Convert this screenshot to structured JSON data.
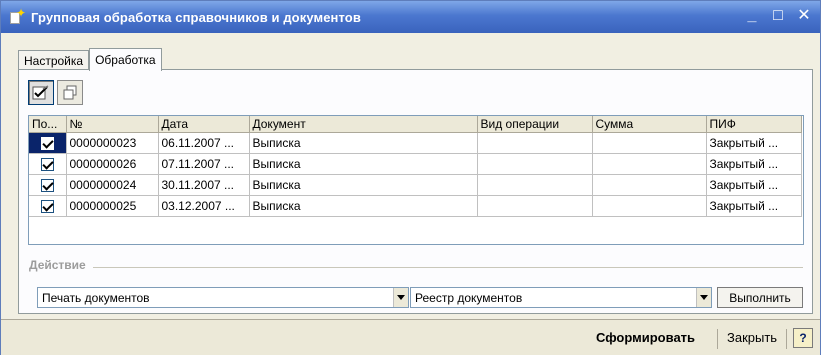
{
  "window": {
    "title": "Групповая обработка справочников и документов",
    "minimize": "_",
    "maximize": "□",
    "close": "✕",
    "title_icon": "document-star-icon"
  },
  "tabs": [
    {
      "label": "Настройка",
      "active": false
    },
    {
      "label": "Обработка",
      "active": true
    }
  ],
  "toolbar": {
    "check_all_icon": "check-all-icon",
    "copy_icon": "copy-icon"
  },
  "table": {
    "columns": [
      "По...",
      "№",
      "Дата",
      "Документ",
      "Вид операции",
      "Сумма",
      "ПИФ"
    ],
    "rows": [
      {
        "checked": true,
        "number": "0000000023",
        "date": "06.11.2007 ...",
        "document": "Выписка",
        "operation": "",
        "sum": "",
        "pif": "Закрытый ..."
      },
      {
        "checked": true,
        "number": "0000000026",
        "date": "07.11.2007 ...",
        "document": "Выписка",
        "operation": "",
        "sum": "",
        "pif": "Закрытый ..."
      },
      {
        "checked": true,
        "number": "0000000024",
        "date": "30.11.2007 ...",
        "document": "Выписка",
        "operation": "",
        "sum": "",
        "pif": "Закрытый ..."
      },
      {
        "checked": true,
        "number": "0000000025",
        "date": "03.12.2007 ...",
        "document": "Выписка",
        "operation": "",
        "sum": "",
        "pif": "Закрытый ..."
      }
    ]
  },
  "action": {
    "section_label": "Действие",
    "action_value": "Печать документов",
    "report_value": "Реестр документов",
    "execute_label": "Выполнить"
  },
  "footer": {
    "generate_label": "Сформировать",
    "close_label": "Закрыть",
    "help_label": "?"
  }
}
